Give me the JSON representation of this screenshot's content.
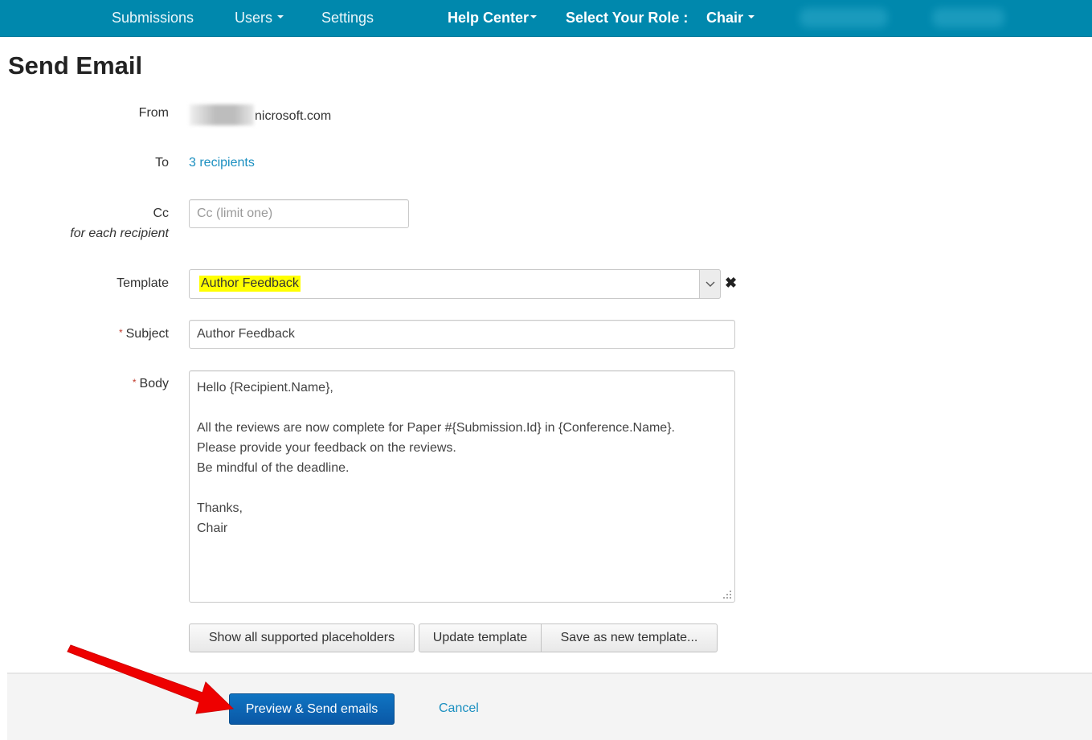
{
  "navbar": {
    "items": [
      {
        "label": "Submissions",
        "has_caret": false
      },
      {
        "label": "Users",
        "has_caret": true
      },
      {
        "label": "Settings",
        "has_caret": false
      },
      {
        "label": "Help Center",
        "has_caret": true
      }
    ],
    "role_label": "Select Your Role :",
    "role_value": "Chair",
    "background_color": "#0088ad"
  },
  "page": {
    "title": "Send Email"
  },
  "form": {
    "from": {
      "label": "From",
      "value_visible": "nicrosoft.com"
    },
    "to": {
      "label": "To",
      "value": "3 recipients"
    },
    "cc": {
      "label": "Cc",
      "sublabel": "for each recipient",
      "placeholder": "Cc (limit one)",
      "value": ""
    },
    "template": {
      "label": "Template",
      "selected": "Author Feedback",
      "highlight_color": "#ffff00"
    },
    "subject": {
      "label": "Subject",
      "required": true,
      "value": "Author Feedback"
    },
    "body": {
      "label": "Body",
      "required": true,
      "value": "Hello {Recipient.Name},\n\nAll the reviews are now complete for Paper #{Submission.Id} in {Conference.Name}.\nPlease provide your feedback on the reviews.\nBe mindful of the deadline.\n\nThanks,\nChair"
    },
    "required_marker": "*"
  },
  "actions": {
    "show_placeholders": "Show all supported placeholders",
    "update_template": "Update template",
    "save_new_template": "Save as new template..."
  },
  "footer": {
    "primary": "Preview & Send emails",
    "cancel": "Cancel",
    "primary_color": "#0a62b0"
  },
  "annotation": {
    "arrow_color": "#ee0000",
    "points_to": "Preview & Send emails"
  }
}
